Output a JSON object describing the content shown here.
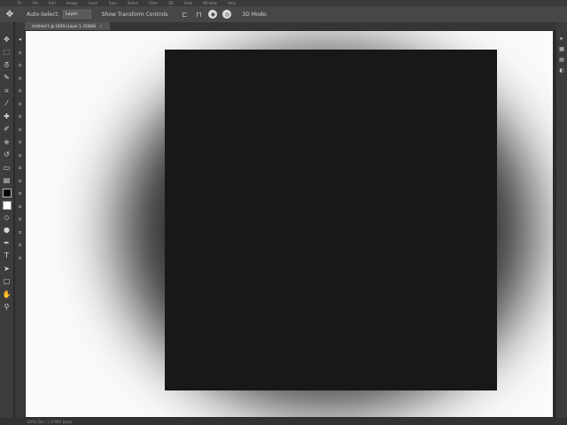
{
  "menubar": {
    "items": [
      "Ps",
      "File",
      "Edit",
      "Image",
      "Layer",
      "Type",
      "Select",
      "Filter",
      "3D",
      "View",
      "Window",
      "Help"
    ]
  },
  "options": {
    "tool_icon": "move-tool-icon",
    "label": "Auto-Select:",
    "field_value": "Layer",
    "toggle_label": "Show Transform Controls",
    "align_icons": [
      "align-left-icon",
      "align-center-icon",
      "align-right-icon",
      "distribute-icon"
    ],
    "mode_label": "3D Mode:"
  },
  "tools": {
    "items": [
      {
        "name": "move-tool",
        "glyph": "✥"
      },
      {
        "name": "marquee-tool",
        "glyph": "⬚"
      },
      {
        "name": "lasso-tool",
        "glyph": "ᘔ"
      },
      {
        "name": "quick-select-tool",
        "glyph": "✎"
      },
      {
        "name": "crop-tool",
        "glyph": "⌗"
      },
      {
        "name": "eyedropper-tool",
        "glyph": "⁄"
      },
      {
        "name": "healing-brush-tool",
        "glyph": "✚"
      },
      {
        "name": "brush-tool",
        "glyph": "✐"
      },
      {
        "name": "clone-stamp-tool",
        "glyph": "⎈"
      },
      {
        "name": "history-brush-tool",
        "glyph": "↺"
      },
      {
        "name": "eraser-tool",
        "glyph": "▭"
      },
      {
        "name": "gradient-tool",
        "glyph": "▤"
      },
      {
        "name": "blur-tool",
        "glyph": "◇"
      },
      {
        "name": "dodge-tool",
        "glyph": "●"
      },
      {
        "name": "pen-tool",
        "glyph": "✒"
      },
      {
        "name": "type-tool",
        "glyph": "T"
      },
      {
        "name": "path-selection-tool",
        "glyph": "➤"
      },
      {
        "name": "shape-tool",
        "glyph": "▢"
      },
      {
        "name": "hand-tool",
        "glyph": "✋"
      },
      {
        "name": "zoom-tool",
        "glyph": "⚲"
      }
    ],
    "fg_color": "#000000",
    "bg_color": "#ffffff"
  },
  "subcol": {
    "items": [
      "◂",
      "▫",
      "▫",
      "▫",
      "▫",
      "▫",
      "▫",
      "▫",
      "▫",
      "▫",
      "▫",
      "▫",
      "▫",
      "▫",
      "▫",
      "▫",
      "▫",
      "▫"
    ]
  },
  "tabbar": {
    "doc_title": "Untitled-1 @ 100% (Layer 1, RGB/8)",
    "close_glyph": "×"
  },
  "canvas": {
    "background_color": "#fafafa",
    "square_color": "#181818"
  },
  "rightpanel": {
    "icons": [
      "panel-collapse-icon",
      "history-icon",
      "properties-icon",
      "adjustments-icon"
    ]
  },
  "status": {
    "text": "100%    Doc: 1.37M/0 bytes"
  }
}
